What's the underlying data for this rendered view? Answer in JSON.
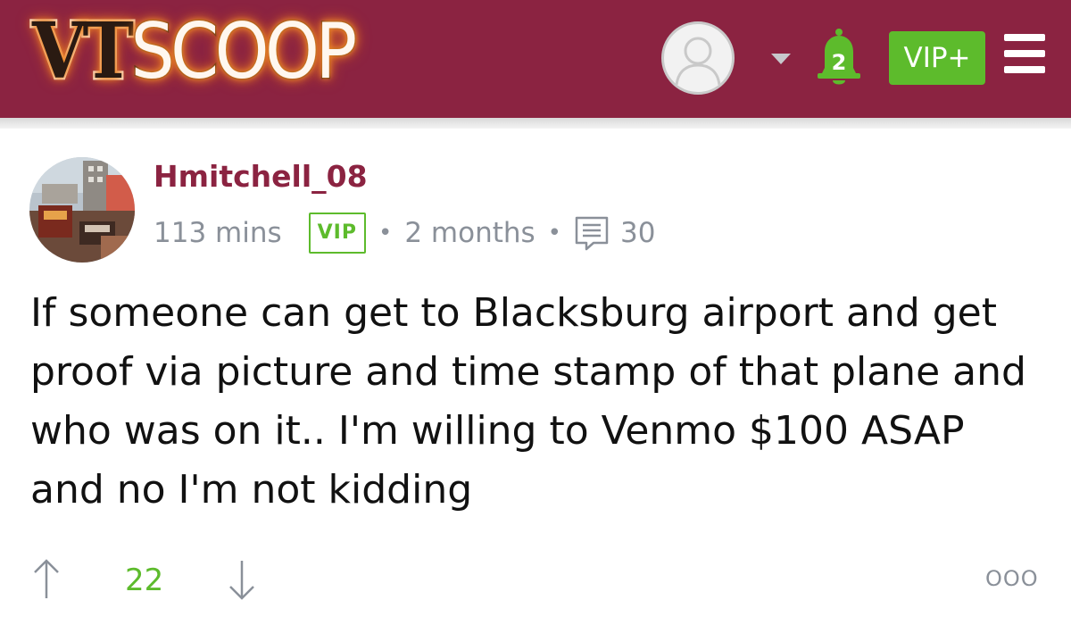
{
  "header": {
    "logo_prefix": "VT",
    "logo_suffix": "SCOOP",
    "notification_count": "2",
    "vip_plus_label": "VIP+"
  },
  "post": {
    "username": "Hmitchell_08",
    "time_on_site": "113 mins",
    "badge": "VIP",
    "member_age": "2 months",
    "comment_count": "30",
    "body": "If someone can get to Blacksburg airport and get proof via picture and time stamp of that plane and who was on it.. I'm willing to Venmo $100 ASAP and no I'm not kidding",
    "vote_count": "22",
    "more_label": "OOO"
  },
  "colors": {
    "header_bg": "#8b2341",
    "accent_green": "#5dbb2c",
    "username": "#8b2341",
    "meta_gray": "#8a9099"
  }
}
